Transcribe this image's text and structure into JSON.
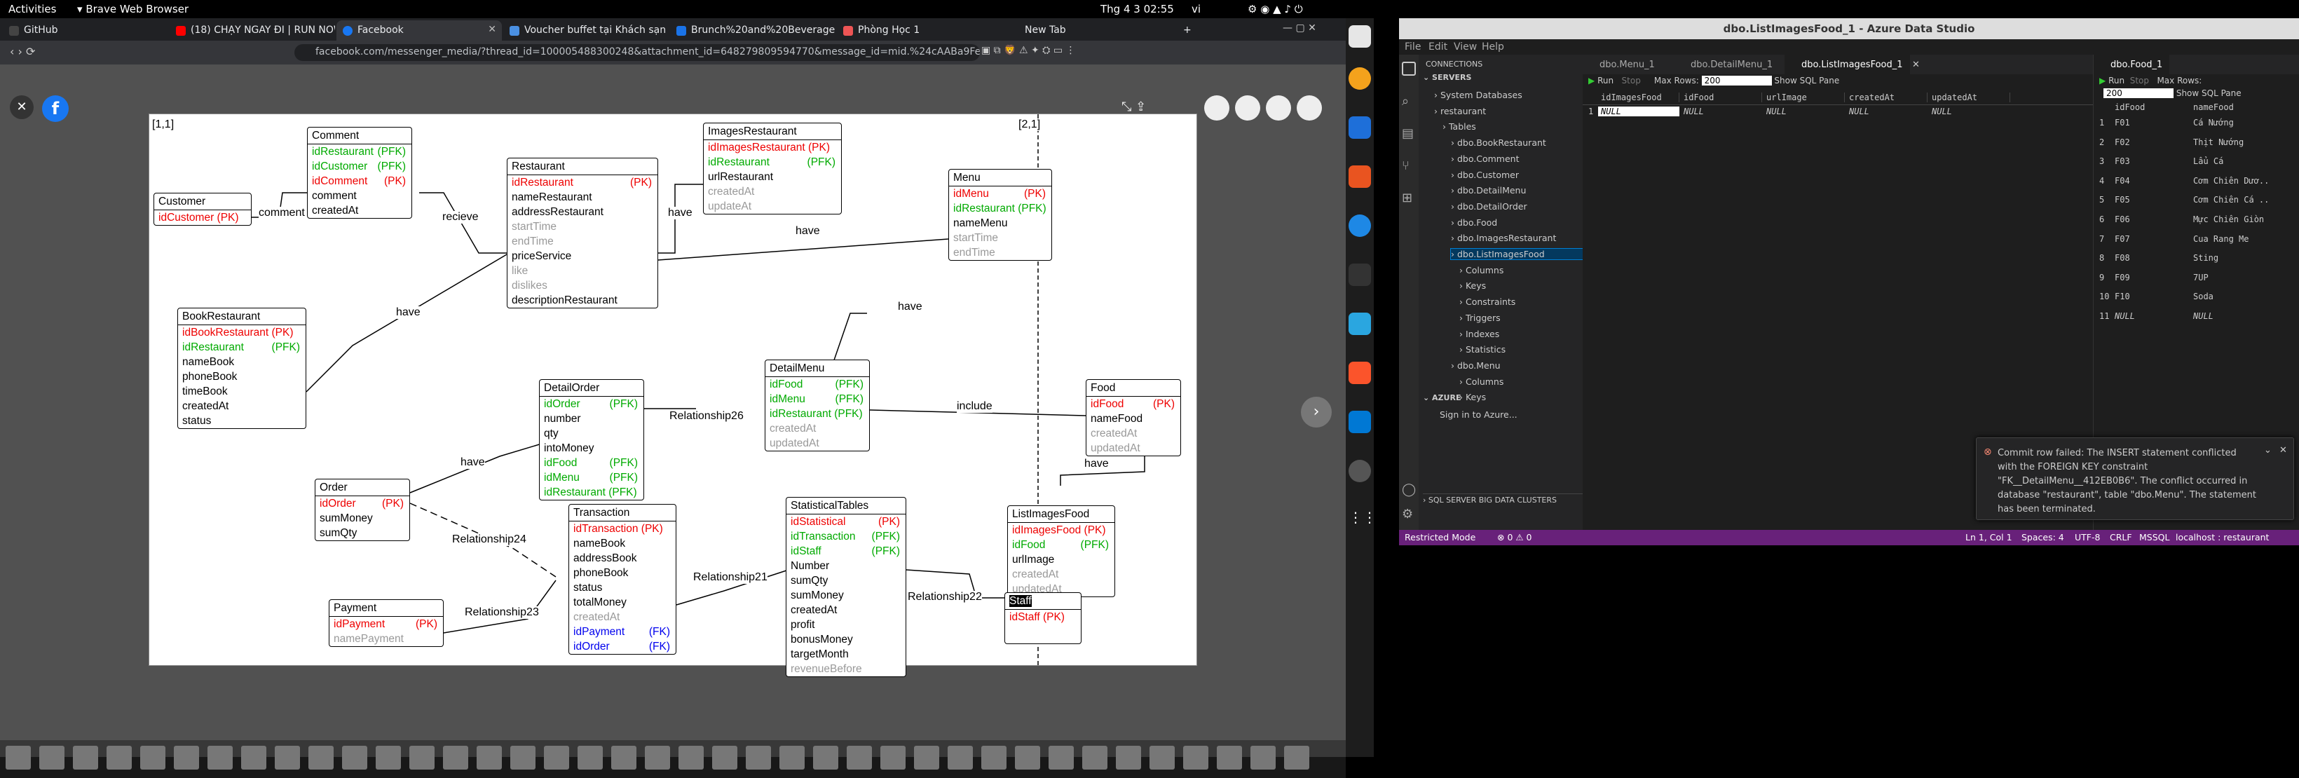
{
  "topbar": {
    "activities": "Activities",
    "app": "Brave Web Browser",
    "clock": "Thg 4 3  02:55",
    "lang": "vi"
  },
  "browser": {
    "tabs": [
      {
        "label": "GitHub",
        "color": "#444"
      },
      {
        "label": "(18) CHẠY NGAY ĐI | RUN NOW",
        "color": "#ff0000"
      },
      {
        "label": "Facebook",
        "color": "#1877f2"
      },
      {
        "label": "Voucher buffet tại Khách sạn",
        "color": "#4a90e2"
      },
      {
        "label": "Brunch%20and%20Beverage",
        "color": "#1a73e8"
      },
      {
        "label": "Phòng Học 1",
        "color": "#e55"
      },
      {
        "label": "New Tab",
        "color": "#202124"
      }
    ],
    "url": "facebook.com/messenger_media/?thread_id=100005488300248&attachment_id=648279809594770&message_id=mid.%24cAABa9FebENiGHDE...",
    "new_tab_plus": "+"
  },
  "diagram": {
    "corner_left": "[1,1]",
    "corner_right": "[2,1]",
    "entities": {
      "customer": {
        "title": "Customer",
        "rows": [
          {
            "t": "idCustomer (PK)",
            "c": "red"
          }
        ]
      },
      "comment": {
        "title": "Comment",
        "rows": [
          {
            "t": "idRestaurant",
            "k": "(PFK)",
            "c": "grn"
          },
          {
            "t": "idCustomer",
            "k": "(PFK)",
            "c": "grn"
          },
          {
            "t": "idComment",
            "k": "(PK)",
            "c": "red"
          },
          {
            "t": "comment",
            "c": ""
          },
          {
            "t": "createdAt",
            "c": ""
          }
        ]
      },
      "restaurant": {
        "title": "Restaurant",
        "rows": [
          {
            "t": "idRestaurant",
            "k": "(PK)",
            "c": "red"
          },
          {
            "t": "nameRestaurant",
            "c": ""
          },
          {
            "t": "addressRestaurant",
            "c": ""
          },
          {
            "t": "startTime",
            "c": "gry"
          },
          {
            "t": "endTime",
            "c": "gry"
          },
          {
            "t": "priceService",
            "c": ""
          },
          {
            "t": "like",
            "c": "gry"
          },
          {
            "t": "dislikes",
            "c": "gry"
          },
          {
            "t": "descriptionRestaurant",
            "c": ""
          }
        ]
      },
      "imagesrestaurant": {
        "title": "ImagesRestaurant",
        "rows": [
          {
            "t": "idImagesRestaurant (PK)",
            "c": "red"
          },
          {
            "t": "idRestaurant",
            "k": "(PFK)",
            "c": "grn"
          },
          {
            "t": "urlRestaurant",
            "c": ""
          },
          {
            "t": "createdAt",
            "c": "gry"
          },
          {
            "t": "updateAt",
            "c": "gry"
          }
        ]
      },
      "menu": {
        "title": "Menu",
        "rows": [
          {
            "t": "idMenu",
            "k": "(PK)",
            "c": "red"
          },
          {
            "t": "idRestaurant (PFK)",
            "c": "grn"
          },
          {
            "t": "nameMenu",
            "c": ""
          },
          {
            "t": "startTime",
            "c": "gry"
          },
          {
            "t": "endTime",
            "c": "gry"
          }
        ]
      },
      "bookrestaurant": {
        "title": "BookRestaurant",
        "rows": [
          {
            "t": "idBookRestaurant (PK)",
            "c": "red"
          },
          {
            "t": "idRestaurant",
            "k": "(PFK)",
            "c": "grn"
          },
          {
            "t": "nameBook",
            "c": ""
          },
          {
            "t": "phoneBook",
            "c": ""
          },
          {
            "t": "timeBook",
            "c": ""
          },
          {
            "t": "createdAt",
            "c": ""
          },
          {
            "t": "status",
            "c": ""
          }
        ]
      },
      "detailorder": {
        "title": "DetailOrder",
        "rows": [
          {
            "t": "idOrder",
            "k": "(PFK)",
            "c": "grn"
          },
          {
            "t": "number",
            "c": ""
          },
          {
            "t": "qty",
            "c": ""
          },
          {
            "t": "intoMoney",
            "c": ""
          },
          {
            "t": "idFood",
            "k": "(PFK)",
            "c": "grn"
          },
          {
            "t": "idMenu",
            "k": "(PFK)",
            "c": "grn"
          },
          {
            "t": "idRestaurant (PFK)",
            "c": "grn"
          }
        ]
      },
      "detailmenu": {
        "title": "DetailMenu",
        "rows": [
          {
            "t": "idFood",
            "k": "(PFK)",
            "c": "grn"
          },
          {
            "t": "idMenu",
            "k": "(PFK)",
            "c": "grn"
          },
          {
            "t": "idRestaurant (PFK)",
            "c": "grn"
          },
          {
            "t": "createdAt",
            "c": "gry"
          },
          {
            "t": "updatedAt",
            "c": "gry"
          }
        ]
      },
      "food": {
        "title": "Food",
        "rows": [
          {
            "t": "idFood",
            "k": "(PK)",
            "c": "red"
          },
          {
            "t": "nameFood",
            "c": ""
          },
          {
            "t": "createdAt",
            "c": "gry"
          },
          {
            "t": "updatedAt",
            "c": "gry"
          }
        ]
      },
      "order": {
        "title": "Order",
        "rows": [
          {
            "t": "idOrder",
            "k": "(PK)",
            "c": "red"
          },
          {
            "t": "sumMoney",
            "c": ""
          },
          {
            "t": "sumQty",
            "c": ""
          }
        ]
      },
      "transaction": {
        "title": "Transaction",
        "rows": [
          {
            "t": "idTransaction (PK)",
            "c": "red"
          },
          {
            "t": "nameBook",
            "c": ""
          },
          {
            "t": "addressBook",
            "c": ""
          },
          {
            "t": "phoneBook",
            "c": ""
          },
          {
            "t": "status",
            "c": ""
          },
          {
            "t": "totalMoney",
            "c": ""
          },
          {
            "t": "createdAt",
            "c": "gry"
          },
          {
            "t": "idPayment",
            "k": "(FK)",
            "c": "blu"
          },
          {
            "t": "idOrder",
            "k": "(FK)",
            "c": "blu"
          }
        ]
      },
      "statisticaltables": {
        "title": "StatisticalTables",
        "rows": [
          {
            "t": "idStatistical",
            "k": "(PK)",
            "c": "red"
          },
          {
            "t": "idTransaction",
            "k": "(PFK)",
            "c": "grn"
          },
          {
            "t": "idStaff",
            "k": "(PFK)",
            "c": "grn"
          },
          {
            "t": "Number",
            "c": ""
          },
          {
            "t": "sumQty",
            "c": ""
          },
          {
            "t": "sumMoney",
            "c": ""
          },
          {
            "t": "createdAt",
            "c": ""
          },
          {
            "t": "profit",
            "c": ""
          },
          {
            "t": "bonusMoney",
            "c": ""
          },
          {
            "t": "targetMonth",
            "c": ""
          },
          {
            "t": "revenueBefore",
            "c": "gry"
          }
        ]
      },
      "listimagesfood": {
        "title": "ListImagesFood",
        "rows": [
          {
            "t": "idImagesFood (PK)",
            "c": "red"
          },
          {
            "t": "idFood",
            "k": "(PFK)",
            "c": "grn"
          },
          {
            "t": "urlImage",
            "c": ""
          },
          {
            "t": "createdAt",
            "c": "gry"
          },
          {
            "t": "updatedAt",
            "c": "gry"
          }
        ]
      },
      "payment": {
        "title": "Payment",
        "rows": [
          {
            "t": "idPayment",
            "k": "(PK)",
            "c": "red"
          },
          {
            "t": "namePayment",
            "c": "gry"
          }
        ]
      },
      "staff": {
        "title": "Staff",
        "rows": [
          {
            "t": "idStaff (PK)",
            "c": "red"
          }
        ]
      }
    },
    "relations": {
      "comment": "comment",
      "recieve": "recieve",
      "have1": "have",
      "have2": "have",
      "have3": "have",
      "have4": "have",
      "have5": "have",
      "have6": "have",
      "include": "include",
      "rel26": "Relationship26",
      "rel24": "Relationship24",
      "rel21": "Relationship21",
      "rel23": "Relationship23",
      "rel22": "Relationship22"
    }
  },
  "ads": {
    "title": "dbo.ListImagesFood_1 - Azure Data Studio",
    "menu": [
      "File",
      "Edit",
      "View",
      "Help"
    ],
    "connections_header": "CONNECTIONS",
    "servers_label": "SERVERS",
    "tree": [
      {
        "label": "System Databases",
        "indent": 1
      },
      {
        "label": "restaurant",
        "indent": 1
      },
      {
        "label": "Tables",
        "indent": 2
      },
      {
        "label": "dbo.BookRestaurant",
        "indent": 3
      },
      {
        "label": "dbo.Comment",
        "indent": 3
      },
      {
        "label": "dbo.Customer",
        "indent": 3
      },
      {
        "label": "dbo.DetailMenu",
        "indent": 3
      },
      {
        "label": "dbo.DetailOrder",
        "indent": 3
      },
      {
        "label": "dbo.Food",
        "indent": 3
      },
      {
        "label": "dbo.ImagesRestaurant",
        "indent": 3
      },
      {
        "label": "dbo.ListImagesFood",
        "indent": 3,
        "selected": true
      },
      {
        "label": "Columns",
        "indent": 4
      },
      {
        "label": "Keys",
        "indent": 4
      },
      {
        "label": "Constraints",
        "indent": 4
      },
      {
        "label": "Triggers",
        "indent": 4
      },
      {
        "label": "Indexes",
        "indent": 4
      },
      {
        "label": "Statistics",
        "indent": 4
      },
      {
        "label": "dbo.Menu",
        "indent": 3
      },
      {
        "label": "Columns",
        "indent": 4
      },
      {
        "label": "Keys",
        "indent": 4
      }
    ],
    "azure_header": "AZURE",
    "azure_signin": "Sign in to Azure...",
    "bigdata": "SQL SERVER BIG DATA CLUSTERS",
    "editor_tabs": [
      "dbo.Menu_1",
      "dbo.DetailMenu_1",
      "dbo.ListImagesFood_1"
    ],
    "right_tab": "dbo.Food_1",
    "run": "Run",
    "stop": "Stop",
    "maxrows_label": "Max Rows:",
    "maxrows": "200",
    "show_sql": "Show SQL Pane",
    "grid1": {
      "columns": [
        "idImagesFood",
        "idFood",
        "urlImage",
        "createdAt",
        "updatedAt"
      ],
      "rows": [
        [
          "1",
          "NULL",
          "NULL",
          "NULL",
          "NULL",
          "NULL"
        ]
      ]
    },
    "grid2": {
      "columns": [
        "idFood",
        "nameFood"
      ],
      "rows": [
        [
          "1",
          "F01",
          "Cá Nướng"
        ],
        [
          "2",
          "F02",
          "Thịt Nướng"
        ],
        [
          "3",
          "F03",
          "Lẩu Cá"
        ],
        [
          "4",
          "F04",
          "Cơm Chiên Dươ..."
        ],
        [
          "5",
          "F05",
          "Cơm Chiên Cá ..."
        ],
        [
          "6",
          "F06",
          "Mực Chiên Giòn"
        ],
        [
          "7",
          "F07",
          "Cua Rang Me"
        ],
        [
          "8",
          "F08",
          "Sting"
        ],
        [
          "9",
          "F09",
          "7UP"
        ],
        [
          "10",
          "F10",
          "Soda"
        ],
        [
          "11",
          "NULL",
          "NULL"
        ]
      ]
    },
    "notification": "Commit row failed: The INSERT statement conflicted with the FOREIGN KEY constraint \"FK__DetailMenu__412EB0B6\". The conflict occurred in database \"restaurant\", table \"dbo.Menu\". The statement has been terminated.",
    "status": {
      "restricted": "Restricted Mode",
      "problems": "⊗ 0 ⚠ 0",
      "pos": "Ln 1, Col 1",
      "spaces": "Spaces: 4",
      "enc": "UTF-8",
      "eol": "CRLF",
      "lang": "MSSQL",
      "conn": "localhost : restaurant"
    }
  }
}
